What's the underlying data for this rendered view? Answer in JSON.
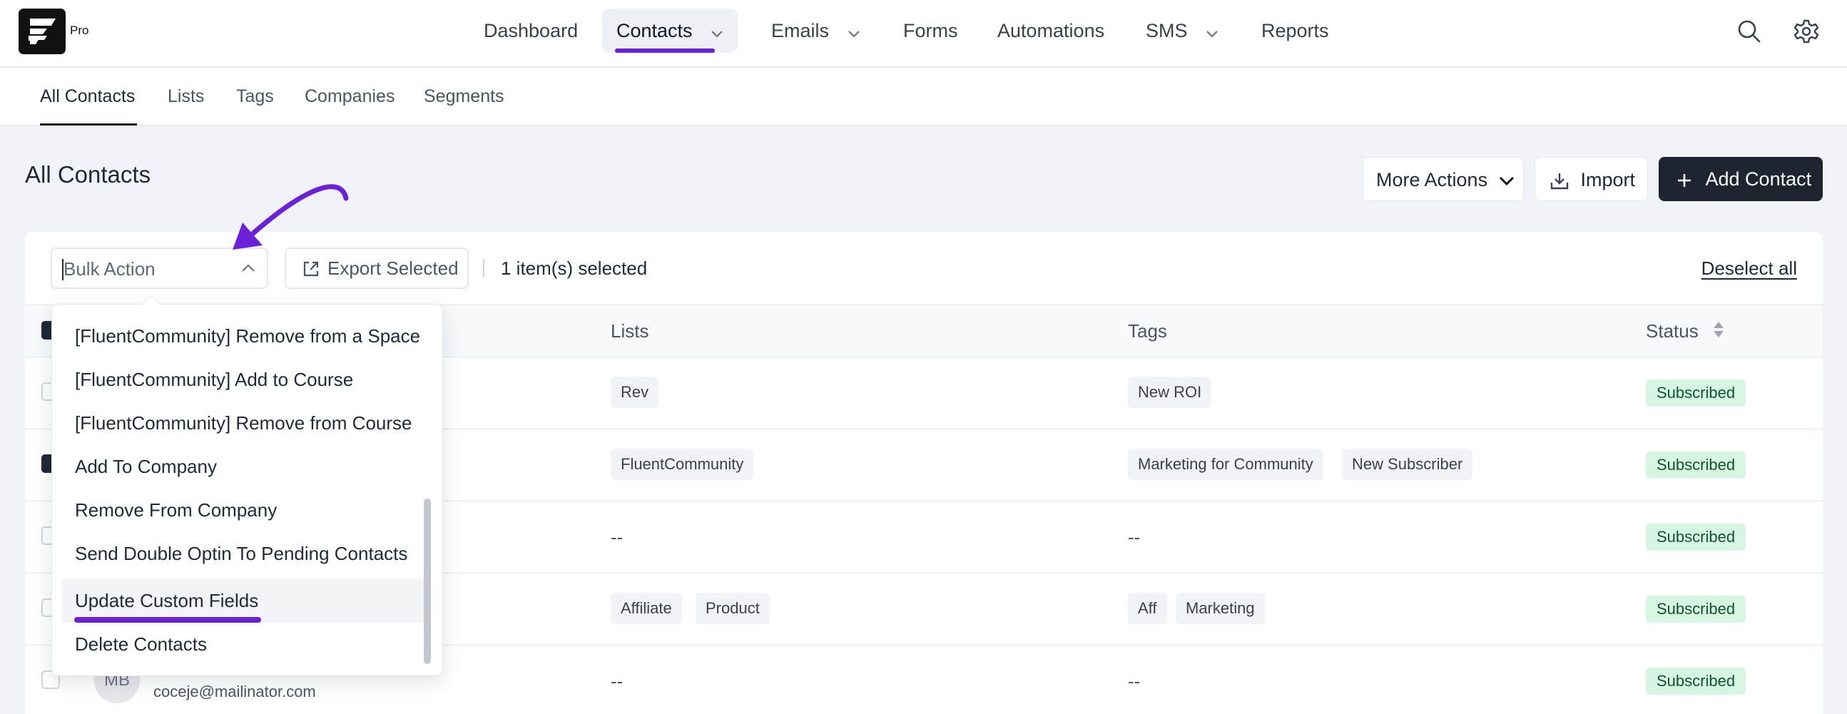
{
  "brand": {
    "badge": "Pro"
  },
  "nav": {
    "items": [
      {
        "label": "Dashboard"
      },
      {
        "label": "Contacts"
      },
      {
        "label": "Emails"
      },
      {
        "label": "Forms"
      },
      {
        "label": "Automations"
      },
      {
        "label": "SMS"
      },
      {
        "label": "Reports"
      }
    ],
    "active": "Contacts"
  },
  "subnav": {
    "items": [
      {
        "label": "All Contacts"
      },
      {
        "label": "Lists"
      },
      {
        "label": "Tags"
      },
      {
        "label": "Companies"
      },
      {
        "label": "Segments"
      }
    ],
    "active": "All Contacts"
  },
  "page": {
    "title": "All Contacts",
    "more_actions": "More Actions",
    "import": "Import",
    "add_contact": "Add Contact"
  },
  "toolbar": {
    "bulk_placeholder": "Bulk Action",
    "export_selected": "Export Selected",
    "selected_count": "1 item(s) selected",
    "deselect_all": "Deselect all"
  },
  "table": {
    "columns": [
      "Lists",
      "Tags",
      "Status"
    ],
    "rows": [
      {
        "lists": [
          "Rev"
        ],
        "tags": [
          "New ROI"
        ],
        "status": "Subscribed",
        "checked": false
      },
      {
        "lists": [
          "FluentCommunity"
        ],
        "tags": [
          "Marketing for Community",
          "New Subscriber"
        ],
        "status": "Subscribed",
        "checked": true
      },
      {
        "lists_empty": "--",
        "tags_empty": "--",
        "status": "Subscribed",
        "checked": false
      },
      {
        "lists": [
          "Affiliate",
          "Product"
        ],
        "tags": [
          "Aff",
          "Marketing"
        ],
        "status": "Subscribed",
        "checked": false
      },
      {
        "avatar_initials": "MB",
        "email": "coceje@mailinator.com",
        "lists_empty": "--",
        "tags_empty": "--",
        "status": "Subscribed",
        "checked": false
      }
    ]
  },
  "bulk_dropdown": {
    "options": [
      "[FluentCommunity] Remove from a Space",
      "[FluentCommunity] Add to Course",
      "[FluentCommunity] Remove from Course",
      "Add To Company",
      "Remove From Company",
      "Send Double Optin To Pending Contacts",
      "Update Custom Fields",
      "Delete Contacts"
    ],
    "highlighted": "Update Custom Fields"
  },
  "colors": {
    "accent": "#6b21d8",
    "dark_button": "#1e2430",
    "status_bg": "#d6f5e3",
    "status_text": "#14532d",
    "page_bg": "#f1f3f9"
  },
  "icons": [
    "logo-icon",
    "chevron-down-icon",
    "search-icon",
    "gear-icon",
    "import-icon",
    "plus-icon",
    "export-icon",
    "chevron-up-icon",
    "sort-icon",
    "arrow-annotation-icon"
  ]
}
